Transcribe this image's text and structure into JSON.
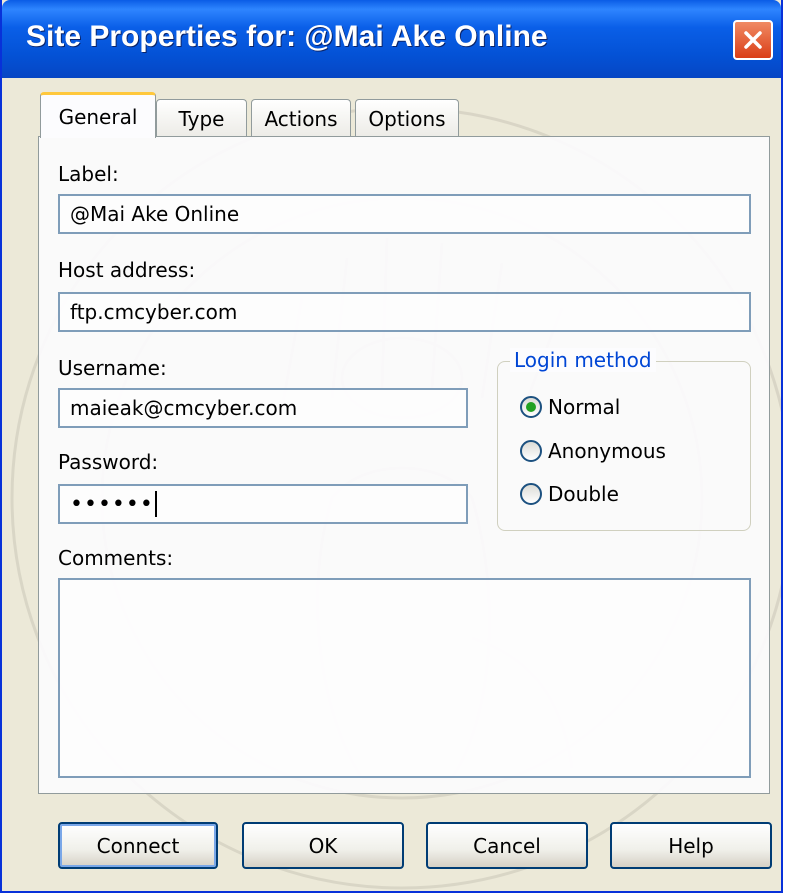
{
  "window": {
    "title": "Site Properties for: @Mai Ake Online"
  },
  "tabs": [
    {
      "label": "General",
      "active": true
    },
    {
      "label": "Type",
      "active": false
    },
    {
      "label": "Actions",
      "active": false
    },
    {
      "label": "Options",
      "active": false
    }
  ],
  "form": {
    "label": {
      "caption": "Label:",
      "value": "@Mai Ake Online"
    },
    "host": {
      "caption": "Host address:",
      "value": "ftp.cmcyber.com"
    },
    "username": {
      "caption": "Username:",
      "value": "maieak@cmcyber.com"
    },
    "password": {
      "caption": "Password:",
      "masked_value": "••••••"
    },
    "comments": {
      "caption": "Comments:",
      "value": ""
    }
  },
  "login_method": {
    "title": "Login method",
    "options": [
      {
        "label": "Normal",
        "selected": true
      },
      {
        "label": "Anonymous",
        "selected": false
      },
      {
        "label": "Double",
        "selected": false
      }
    ]
  },
  "buttons": {
    "connect": "Connect",
    "ok": "OK",
    "cancel": "Cancel",
    "help": "Help"
  },
  "colors": {
    "titlebar": "#0A5FE8",
    "dialog_bg": "#ECE9D8",
    "group_title": "#0046D5",
    "radio_selected": "#21A121",
    "close_button": "#DA3E17"
  },
  "icons": {
    "close": "close-icon"
  }
}
